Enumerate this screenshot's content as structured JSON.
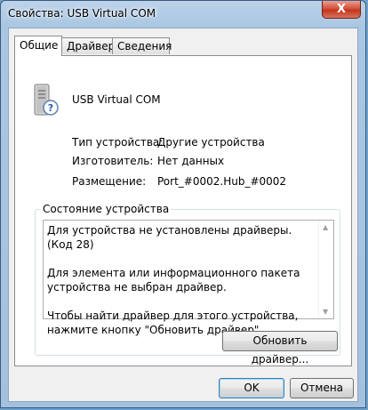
{
  "window": {
    "title": "Свойства: USB Virtual COM",
    "close_symbol": "X"
  },
  "tabs": [
    {
      "label": "Общие",
      "active": true
    },
    {
      "label": "Драйвер",
      "active": false
    },
    {
      "label": "Сведения",
      "active": false
    }
  ],
  "device": {
    "name": "USB Virtual COM",
    "icon": "unknown-usb-device-icon"
  },
  "properties": [
    {
      "label": "Тип устройства:",
      "value": "Другие устройства"
    },
    {
      "label": "Изготовитель:",
      "value": "Нет данных"
    },
    {
      "label": "Размещение:",
      "value": "Port_#0002.Hub_#0002"
    }
  ],
  "status": {
    "group_title": "Состояние устройства",
    "line1": "Для устройства не установлены драйверы. (Код 28)",
    "line2": "Для элемента или информационного пакета устройства не выбран драйвер.",
    "line3": "Чтобы найти драйвер для этого устройства, нажмите кнопку \"Обновить драйвер\".",
    "update_button": "Обновить драйвер..."
  },
  "footer": {
    "ok_label": "OK",
    "cancel_label": "Отмена"
  }
}
